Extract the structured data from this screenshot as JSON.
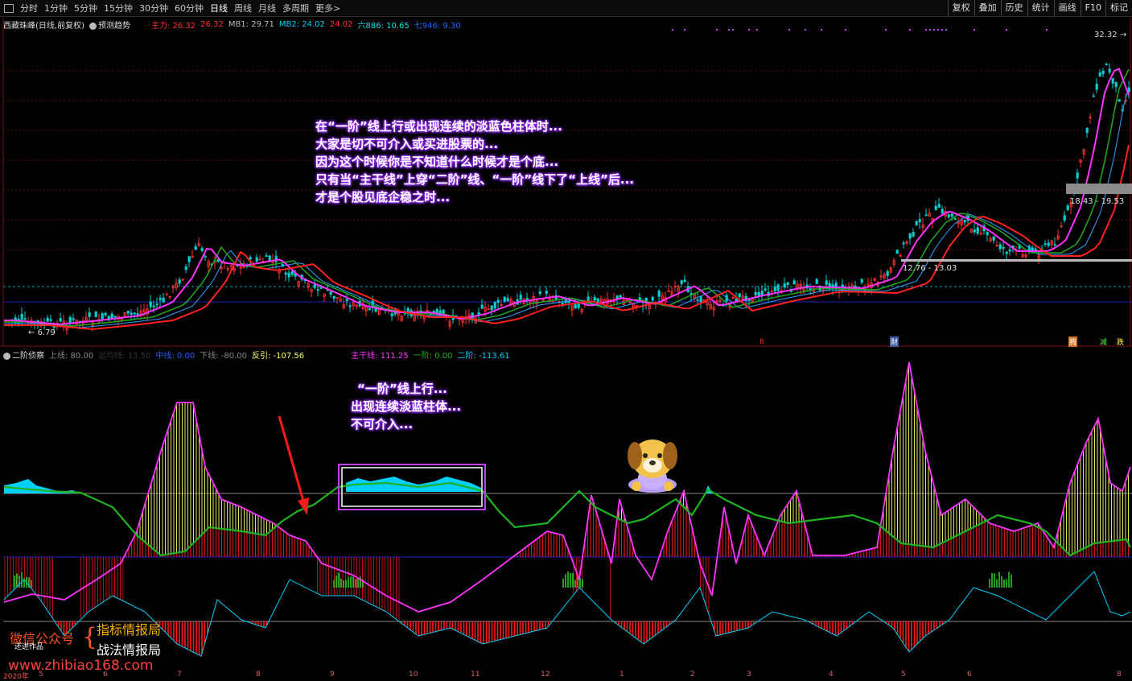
{
  "toolbar": {
    "periods": [
      "分时",
      "1分钟",
      "5分钟",
      "15分钟",
      "30分钟",
      "60分钟",
      "日线",
      "周线",
      "月线",
      "多周期",
      "更多>"
    ],
    "active_period": "日线",
    "right_buttons": [
      "复权",
      "叠加",
      "历史",
      "统计",
      "画线",
      "F10",
      "标记"
    ]
  },
  "main_legend": {
    "stock": "西藏珠峰(日线,前复权)",
    "forecast": "预测趋势",
    "zhuli_label": "主力: 26.32",
    "zhuli_value": "26.32",
    "mb1": "MB1: 29.71",
    "mb2": "MB2: 24.02",
    "mb2_value": "24.02",
    "liu": "六886: 10.65",
    "qi": "七946: 9.30"
  },
  "price_labels": {
    "high": "32.32",
    "low": "6.79",
    "zone_upper": "18.43 - 19.53",
    "zone_lower": "12.76 - 13.03"
  },
  "annotation_main": [
    "在“一阶”线上行或出现连续的淡蓝色柱体时...",
    "大家是切不可介入或买进股票的...",
    "因为这个时候你是不知道什么时候才是个底...",
    "只有当“主干线”上穿“二阶”线、“一阶”线下了“上线”后...",
    "才是个股见底企稳之时..."
  ],
  "sub_legend": {
    "name": "二阶侦察",
    "shangxian": "上线: 80.00",
    "faded": "运均线: 13.50",
    "zhongxian": "中线: 0.00",
    "xiaxian": "下线: -80.00",
    "fanyin": "反引: -107.56",
    "zhugan": "主干线: 111.25",
    "yijie": "一阶: 0.00",
    "erjie": "二阶: -113.61"
  },
  "annotation_sub": [
    "“一阶”线上行...",
    "出现连续淡蓝柱体...",
    "不可介入..."
  ],
  "event_flags": {
    "cai": "财",
    "teng": "腾",
    "jian": "减",
    "die": "跌"
  },
  "watermark": {
    "wechat": "微信公众号",
    "item1": "指标情报局",
    "item2": "战法情报局",
    "small": "还进作品",
    "url": "www.zhibiao168.com"
  },
  "date_axis": {
    "year": "2020年",
    "months": [
      "5",
      "6",
      "7",
      "8",
      "9",
      "10",
      "11",
      "12",
      "1",
      "2",
      "3",
      "4",
      "5",
      "6",
      "8"
    ]
  },
  "colors": {
    "red": "#ff2020",
    "magenta": "#ff33ff",
    "green": "#1fb41f",
    "cyan": "#00cfff",
    "yellow": "#ffff66"
  }
}
